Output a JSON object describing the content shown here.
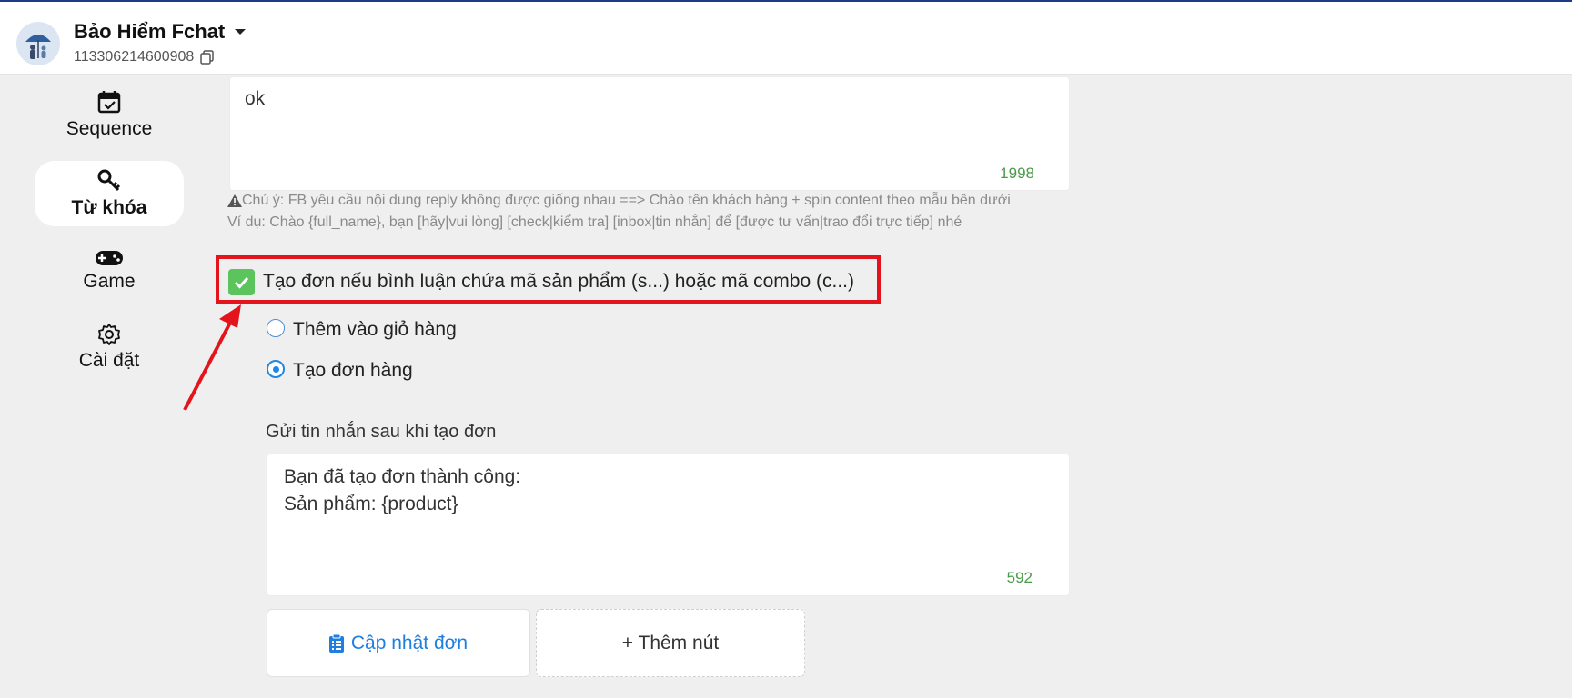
{
  "header": {
    "page_name": "Bảo Hiểm Fchat",
    "page_id": "113306214600908"
  },
  "sidebar": {
    "items": [
      {
        "label": "Sequence",
        "icon": "calendar-check-icon"
      },
      {
        "label": "Từ khóa",
        "icon": "key-icon",
        "active": true
      },
      {
        "label": "Game",
        "icon": "gamepad-icon"
      },
      {
        "label": "Cài đặt",
        "icon": "gear-icon"
      }
    ]
  },
  "reply": {
    "text": "ok",
    "counter": "1998"
  },
  "notes": {
    "warning": "Chú ý: FB yêu cầu nội dung reply không được giống nhau ==> Chào tên khách hàng + spin content theo mẫu bên dưới",
    "example": "Ví dụ: Chào {full_name}, bạn [hãy|vui lòng] [check|kiểm tra] [inbox|tin nhắn] để [được tư vấn|trao đổi trực tiếp] nhé"
  },
  "order_option": {
    "checkbox_label": "Tạo đơn nếu bình luận chứa mã sản phẩm (s...) hoặc mã combo (c...)",
    "checked": true,
    "radio_options": [
      {
        "label": "Thêm vào giỏ hàng",
        "selected": false
      },
      {
        "label": "Tạo đơn hàng",
        "selected": true
      }
    ]
  },
  "after_order": {
    "label": "Gửi tin nhắn sau khi tạo đơn",
    "message": "Bạn đã tạo đơn thành công:\nSản phẩm: {product}",
    "counter": "592"
  },
  "buttons": {
    "update_label": "Cập nhật đơn",
    "add_label": "+ Thêm nút"
  },
  "colors": {
    "accent_blue": "#1e7fe0",
    "check_green": "#5cc45c",
    "highlight_red": "#e3141b",
    "counter_green": "#4a9a4a"
  }
}
